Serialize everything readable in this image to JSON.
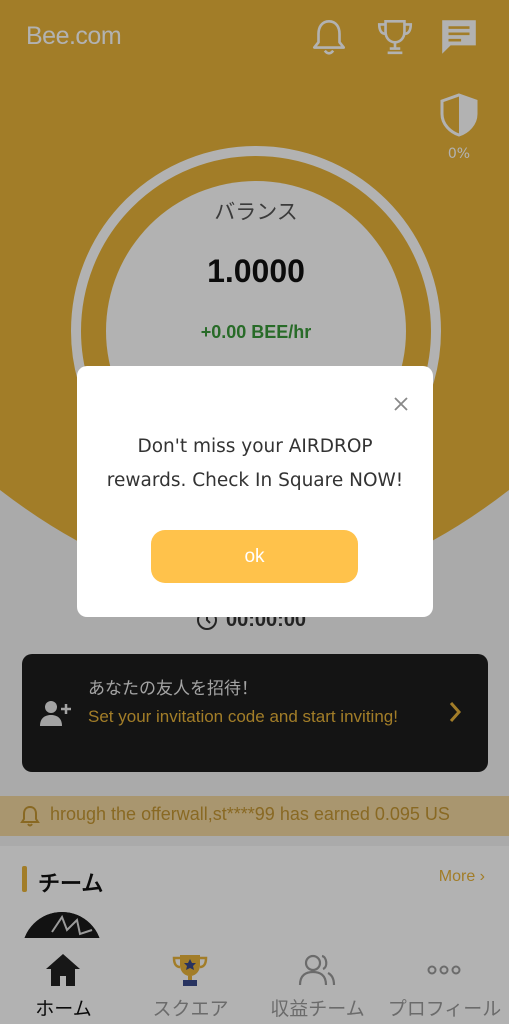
{
  "header": {
    "logo": "Bee.com",
    "icons": [
      "bell-icon",
      "trophy-icon",
      "chat-icon"
    ],
    "shield_percent": "0%"
  },
  "balance": {
    "label": "バランス",
    "value": "1.0000",
    "rate": "+0.00 BEE/hr"
  },
  "timer": {
    "value": "00:00:00"
  },
  "invite": {
    "title": "あなたの友人を招待！",
    "subtitle": "Set your invitation code and start inviting!"
  },
  "ticker": {
    "text": "hrough the offerwall,st****99 has earned 0.095 US"
  },
  "team": {
    "title": "チーム",
    "more": "More"
  },
  "nav": {
    "items": [
      {
        "label": "ホーム",
        "icon": "home-icon",
        "active": true
      },
      {
        "label": "スクエア",
        "icon": "trophy-star-icon",
        "active": false
      },
      {
        "label": "収益チーム",
        "icon": "team-icon",
        "active": false
      },
      {
        "label": "プロフィール",
        "icon": "more-dots-icon",
        "active": false
      }
    ]
  },
  "modal": {
    "message": "Don't miss your AIRDROP rewards. Check In Square NOW!",
    "ok_label": "ok"
  },
  "colors": {
    "brand": "#e8b43a",
    "ok_button": "#ffc24b",
    "rate_green": "#3a9a3a",
    "ticker_bg": "#f3d7a0"
  }
}
